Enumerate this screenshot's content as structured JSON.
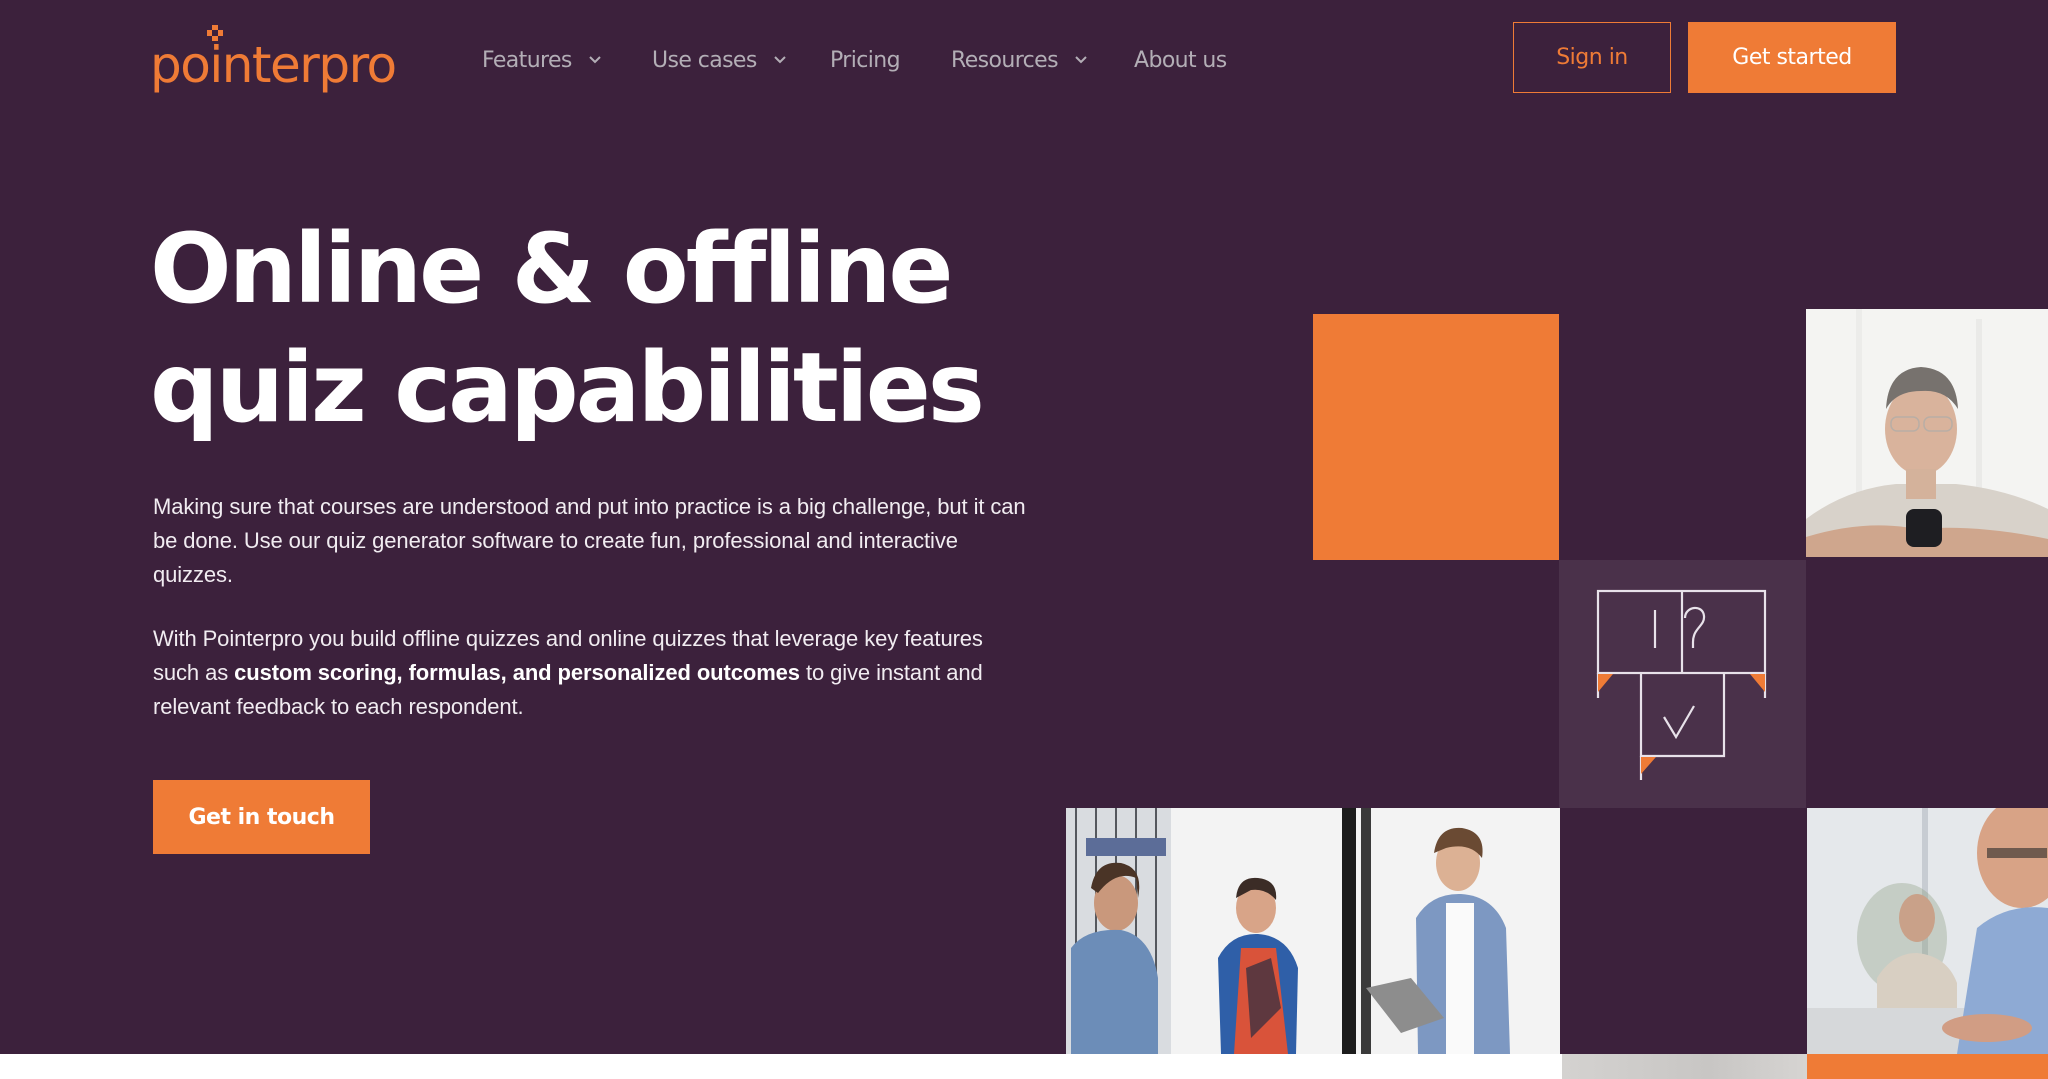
{
  "brand": {
    "name": "pointerpro",
    "colors": {
      "background": "#3c213c",
      "accent": "#ef7b36",
      "icon_tile": "#4a314a",
      "nav_text": "#b3aeb6",
      "text": "#ffffff"
    }
  },
  "header": {
    "logo_text": "pointerpro",
    "nav": [
      {
        "label": "Features",
        "has_dropdown": true
      },
      {
        "label": "Use cases",
        "has_dropdown": true
      },
      {
        "label": "Pricing",
        "has_dropdown": false
      },
      {
        "label": "Resources",
        "has_dropdown": true
      },
      {
        "label": "About us",
        "has_dropdown": false
      }
    ],
    "sign_in_label": "Sign in",
    "get_started_label": "Get started"
  },
  "hero": {
    "title_line1": "Online & offline",
    "title_line2": "quiz capabilities",
    "paragraph1": "Making sure that courses are understood and put into practice is a big challenge, but it can be done. Use our quiz generator software to create fun, professional and interactive quizzes.",
    "paragraph2_before": "With Pointerpro you build offline quizzes and online quizzes that leverage key features such as ",
    "paragraph2_bold": "custom scoring, formulas, and personalized outcomes",
    "paragraph2_after": " to give instant and relevant feedback to each respondent.",
    "cta_label": "Get in touch"
  },
  "mosaic": {
    "tiles": [
      {
        "type": "color-block",
        "icon": "none"
      },
      {
        "type": "illustration",
        "icon": "quiz-speech-bubbles-icon",
        "symbols": [
          "!",
          "?",
          "✓"
        ]
      },
      {
        "type": "photo",
        "subject": "man-with-glasses-holding-mug"
      },
      {
        "type": "photo",
        "subject": "colleagues-talking-with-laptop"
      },
      {
        "type": "photo",
        "subject": "older-man-in-meeting"
      }
    ]
  }
}
